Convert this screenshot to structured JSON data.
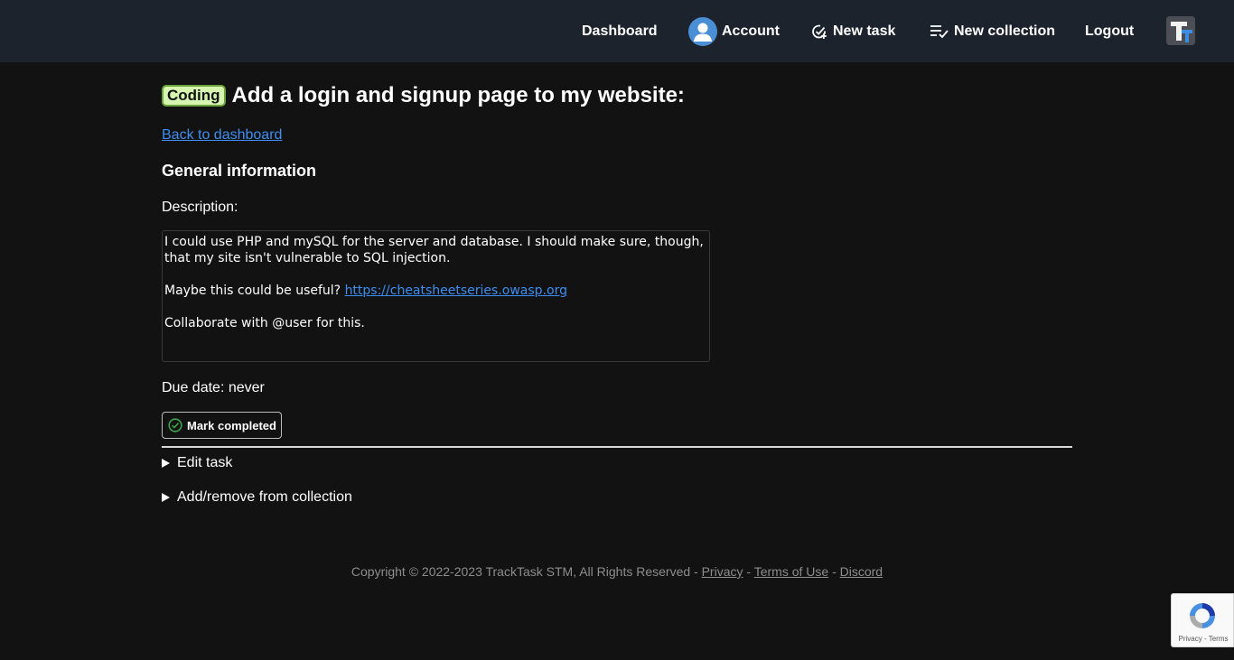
{
  "nav": {
    "dashboard": "Dashboard",
    "account": "Account",
    "new_task": "New task",
    "new_collection": "New collection",
    "logout": "Logout"
  },
  "task": {
    "category": "Coding",
    "title": "Add a login and signup page to my website:",
    "back_link": "Back to dashboard",
    "section_heading": "General information",
    "description_label": "Description:",
    "description": {
      "line1": "I could use PHP and mySQL for the server and database. I should make sure, though, that my site isn't vulnerable to SQL injection.",
      "line2_prefix": "Maybe this could be useful? ",
      "line2_link": "https://cheatsheetseries.owasp.org",
      "line3": "Collaborate with @user for this."
    },
    "due_date": "Due date: never",
    "mark_completed": "Mark completed",
    "edit_task": "Edit task",
    "collection": "Add/remove from collection"
  },
  "footer": {
    "copyright": "Copyright © 2022-2023 TrackTask STM, All Rights Reserved -",
    "privacy": "Privacy",
    "terms": "Terms of Use",
    "discord": "Discord",
    "sep": "-"
  },
  "recaptcha": {
    "text": "Privacy - Terms"
  },
  "colors": {
    "topbar": "#1c232c",
    "background": "#121212",
    "link": "#3d8ef0",
    "badge_bg": "#d5f5b0",
    "badge_border": "#6ca23b",
    "check_green": "#3fa34d"
  },
  "icons": {
    "account": "user-avatar-icon",
    "new_task": "add-task-icon",
    "new_collection": "playlist-check-icon",
    "mark_completed": "check-circle-icon",
    "profile": "tracktask-logo-icon",
    "recaptcha": "recaptcha-icon"
  }
}
